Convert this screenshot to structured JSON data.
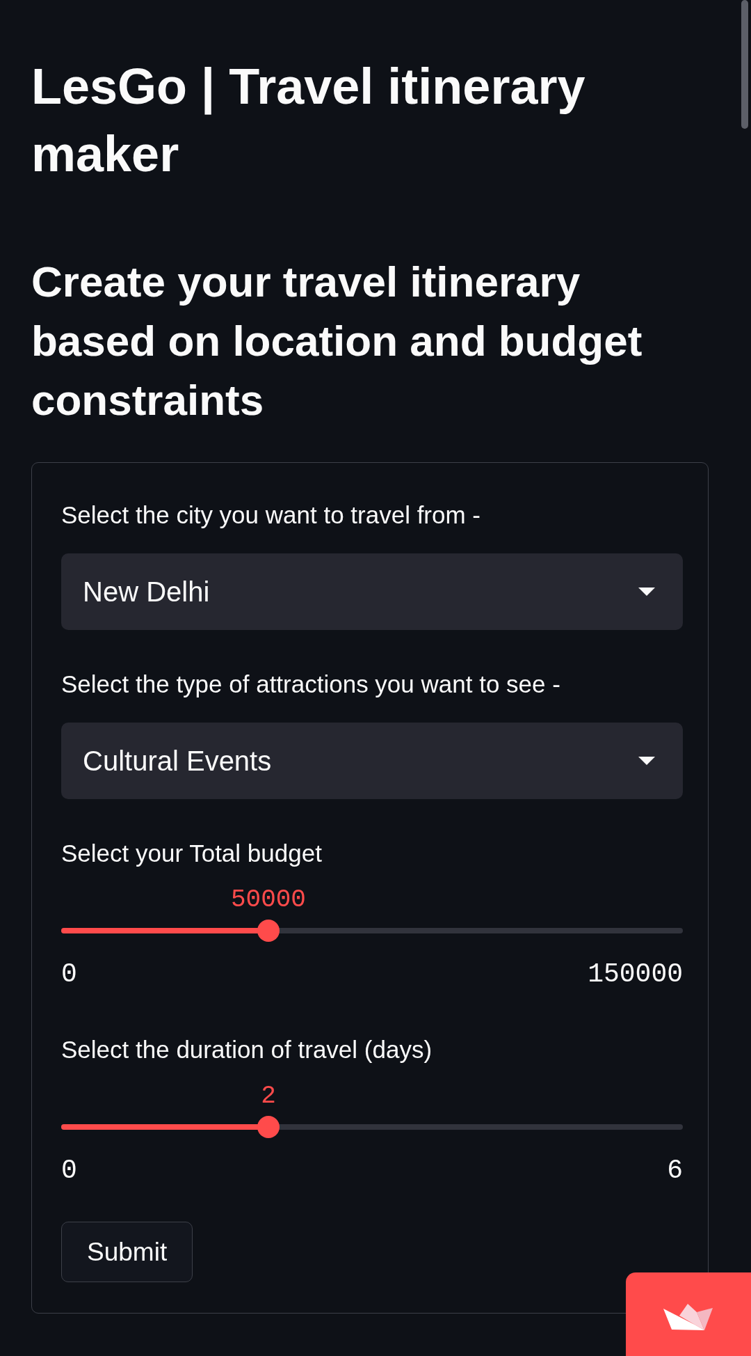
{
  "title": "LesGo | Travel itinerary maker",
  "subtitle": "Create your travel itinerary based on location and budget constraints",
  "form": {
    "fields": [
      {
        "kind": "select",
        "label": "Select the city you want to travel from -",
        "value": "New Delhi"
      },
      {
        "kind": "select",
        "label": "Select the type of attractions you want to see -",
        "value": "Cultural Events"
      },
      {
        "kind": "slider",
        "label": "Select your Total budget",
        "reading": "50000",
        "level": 0.3333,
        "min": "0",
        "max": "150000"
      },
      {
        "kind": "slider",
        "label": "Select the duration of travel (days)",
        "reading": "2",
        "level": 0.3333,
        "min": "0",
        "max": "6"
      }
    ],
    "submit_button": "Submit"
  }
}
